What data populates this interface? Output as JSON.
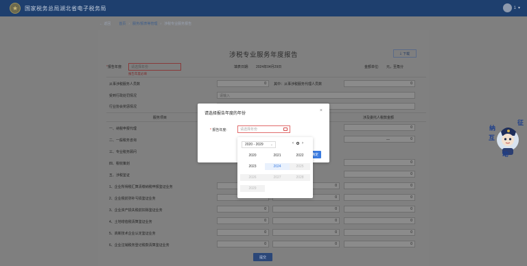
{
  "header": {
    "brand": "国家税务总局湖北省电子税务局",
    "user_name": "1"
  },
  "breadcrumb": {
    "back": "返回",
    "items": [
      "首页",
      "服务/报表等管理",
      "涉税专业服务报告"
    ]
  },
  "page": {
    "title": "涉税专业服务年度报告",
    "download": "下载",
    "year_label": "报告年度:",
    "year_placeholder": "请选择年份",
    "year_error": "报告年度必填",
    "fill_date_label": "填表日期:",
    "fill_date": "2024年04月29日",
    "unit_label": "金额单位:",
    "unit": "元，至角分",
    "rows": [
      {
        "label": "从事涉税服务人员数",
        "value": "0",
        "label2": "其中：从事涉税服务代理人员数",
        "value2": "0"
      },
      {
        "label": "受到行政处罚情况",
        "placeholder": "请输入"
      },
      {
        "label": "行业协会奖惩情况",
        "placeholder": ""
      }
    ],
    "table_headers": [
      "服务项目",
      "涉及委托人税款金额"
    ],
    "services": [
      "一、纳税申报代理",
      "二、一般税务咨询",
      "三、专业税务顾问",
      "四、税收策划",
      "五、涉税鉴证",
      "1、企业所得税汇算清缴纳税申报鉴证业务",
      "2、企业税前弥补亏损鉴证业务",
      "3、企业资产损失税前扣除鉴证业务",
      "4、土地增值税清算鉴证业务",
      "5、高新技术企业认定鉴证业务",
      "6、企业注销税务登记税款清算鉴证业务"
    ],
    "service_values": [
      "0",
      "0",
      "—",
      "0",
      "0",
      "0",
      "0",
      "0",
      "0",
      "0",
      "0"
    ],
    "bottom_button": "提交"
  },
  "modal": {
    "title": "请选择报告年度的年份",
    "close_glyph": "×",
    "label": "报告年度:",
    "required_mark": "*",
    "placeholder": "请选择年份",
    "confirm": "确定"
  },
  "picker": {
    "range": "2020 - 2029",
    "years": [
      {
        "y": "2020",
        "state": "normal"
      },
      {
        "y": "2021",
        "state": "normal"
      },
      {
        "y": "2022",
        "state": "normal"
      },
      {
        "y": "2023",
        "state": "normal"
      },
      {
        "y": "2024",
        "state": "current"
      },
      {
        "y": "2025",
        "state": "disabled"
      },
      {
        "y": "2026",
        "state": "disabled"
      },
      {
        "y": "2027",
        "state": "disabled"
      },
      {
        "y": "2028",
        "state": "disabled"
      },
      {
        "y": "2029",
        "state": "disabled"
      }
    ]
  },
  "mascot": {
    "text": [
      "征",
      "纳",
      "互",
      "动"
    ]
  }
}
